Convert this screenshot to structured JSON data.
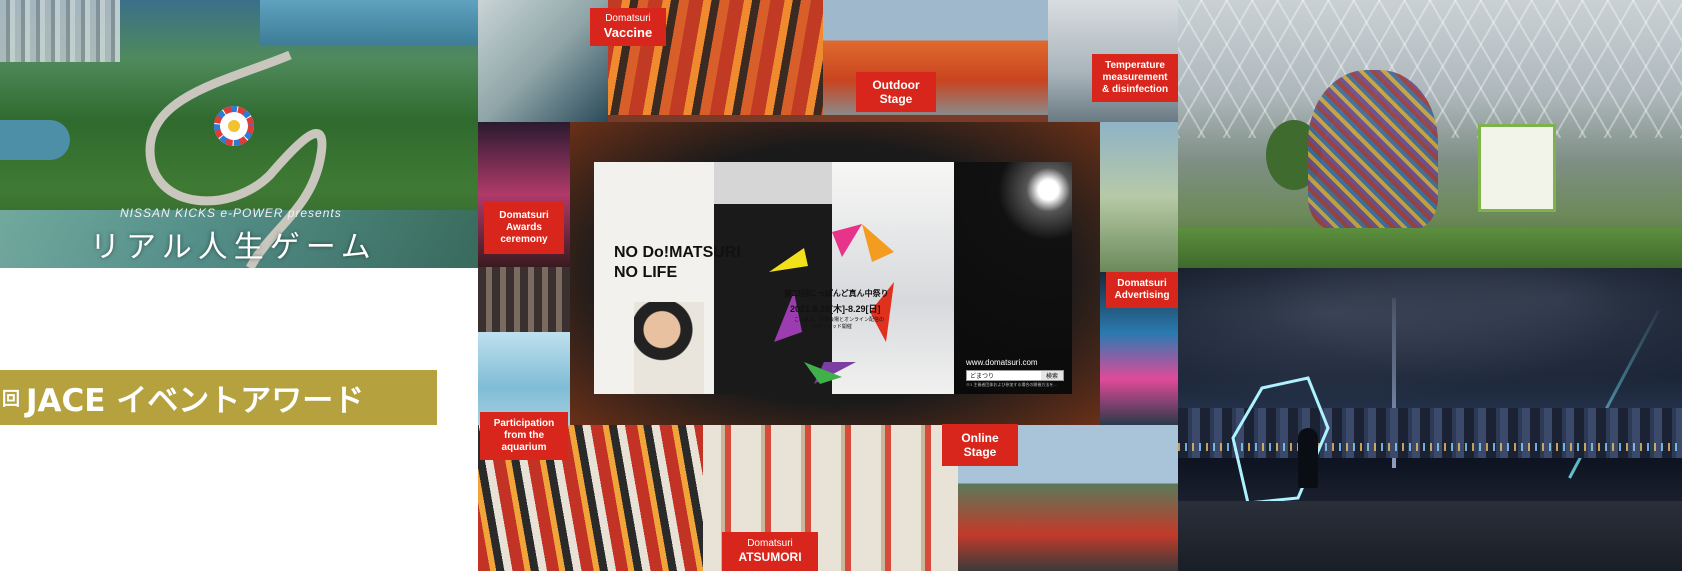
{
  "left_photo": {
    "presenter": "NISSAN KICKS e-POWER presents",
    "title": "リアル人生ゲーム"
  },
  "award_banner": {
    "prefix": "回",
    "text": "JACE イベントアワード"
  },
  "labels": {
    "vaccine": [
      "Domatsuri",
      "Vaccine"
    ],
    "outdoor": [
      "Outdoor",
      "Stage"
    ],
    "temperature": [
      "Temperature",
      "measurement",
      "& disinfection"
    ],
    "awards": [
      "Domatsuri",
      "Awards",
      "ceremony"
    ],
    "advertising": [
      "Domatsuri",
      "Advertising"
    ],
    "aquarium": [
      "Participation",
      "from the",
      "aquarium"
    ],
    "online": [
      "Online",
      "Stage"
    ],
    "atsumori": [
      "Domatsuri",
      "ATSUMORI"
    ]
  },
  "poster": {
    "slogan_1": "NO Do!MATSURI",
    "slogan_2": "NO LIFE",
    "event_name": "第23回にっぽんど真ん中祭り",
    "dates": "2021.8.26[木]-8.29[日]",
    "note_1": "この夏は、外部会場とオンライン配信の",
    "note_2": "ハイブリッド開催",
    "url": "www.domatsuri.com",
    "search_term": "どまつり",
    "search_button": "検索",
    "footnote": "※1 主催者団体および参加する場合の開催方法を..."
  },
  "colors": {
    "label_red": "#d8261c",
    "banner_gold": "#b5a23f"
  }
}
